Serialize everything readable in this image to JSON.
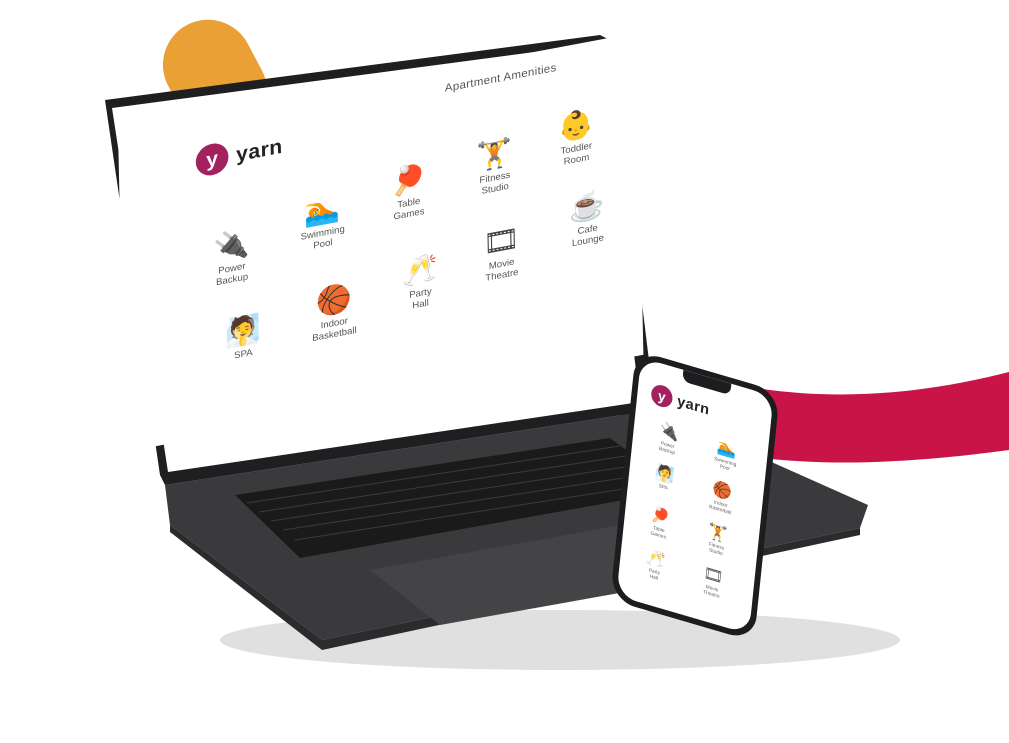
{
  "colors": {
    "brand": "#a3215e",
    "orange": "#e9a034",
    "red": "#c81447"
  },
  "laptop": {
    "title": "Apartment Amenities",
    "brand": {
      "logo_letter": "y",
      "name": "yarn"
    },
    "amenities": [
      {
        "name": "power-backup",
        "label": "Power\nBackup",
        "icon": "plug-icon",
        "glyph": "🔌"
      },
      {
        "name": "swimming-pool",
        "label": "Swimming\nPool",
        "icon": "pool-icon",
        "glyph": "🏊"
      },
      {
        "name": "table-games",
        "label": "Table\nGames",
        "icon": "ping-pong-icon",
        "glyph": "🏓"
      },
      {
        "name": "fitness-studio",
        "label": "Fitness\nStudio",
        "icon": "dumbbell-icon",
        "glyph": "🏋"
      },
      {
        "name": "toddler-room",
        "label": "Toddler\nRoom",
        "icon": "baby-icon",
        "glyph": "👶"
      },
      {
        "name": "spa",
        "label": "SPA",
        "icon": "towel-icon",
        "glyph": "🧖"
      },
      {
        "name": "indoor-basketball",
        "label": "Indoor\nBasketball",
        "icon": "basketball-icon",
        "glyph": "🏀"
      },
      {
        "name": "party-hall",
        "label": "Party\nHall",
        "icon": "glasses-icon",
        "glyph": "🥂"
      },
      {
        "name": "movie-theatre",
        "label": "Movie\nTheatre",
        "icon": "film-icon",
        "glyph": "🎞"
      },
      {
        "name": "cafe-lounge",
        "label": "Cafe\nLounge",
        "icon": "coffee-icon",
        "glyph": "☕"
      }
    ]
  },
  "phone": {
    "brand": {
      "logo_letter": "y",
      "name": "yarn"
    },
    "amenities": [
      {
        "name": "power-backup",
        "label": "Power\nBackup",
        "icon": "plug-icon",
        "glyph": "🔌"
      },
      {
        "name": "swimming-pool",
        "label": "Swimming\nPool",
        "icon": "pool-icon",
        "glyph": "🏊"
      },
      {
        "name": "spa",
        "label": "SPA",
        "icon": "towel-icon",
        "glyph": "🧖"
      },
      {
        "name": "indoor-basketball",
        "label": "Indoor\nBasketball",
        "icon": "basketball-icon",
        "glyph": "🏀"
      },
      {
        "name": "table-games",
        "label": "Table\nGames",
        "icon": "ping-pong-icon",
        "glyph": "🏓"
      },
      {
        "name": "fitness-studio",
        "label": "Fitness\nStudio",
        "icon": "dumbbell-icon",
        "glyph": "🏋"
      },
      {
        "name": "party-hall",
        "label": "Party\nHall",
        "icon": "glasses-icon",
        "glyph": "🥂"
      },
      {
        "name": "movie-theatre",
        "label": "Movie\nTheatre",
        "icon": "film-icon",
        "glyph": "🎞"
      }
    ]
  }
}
